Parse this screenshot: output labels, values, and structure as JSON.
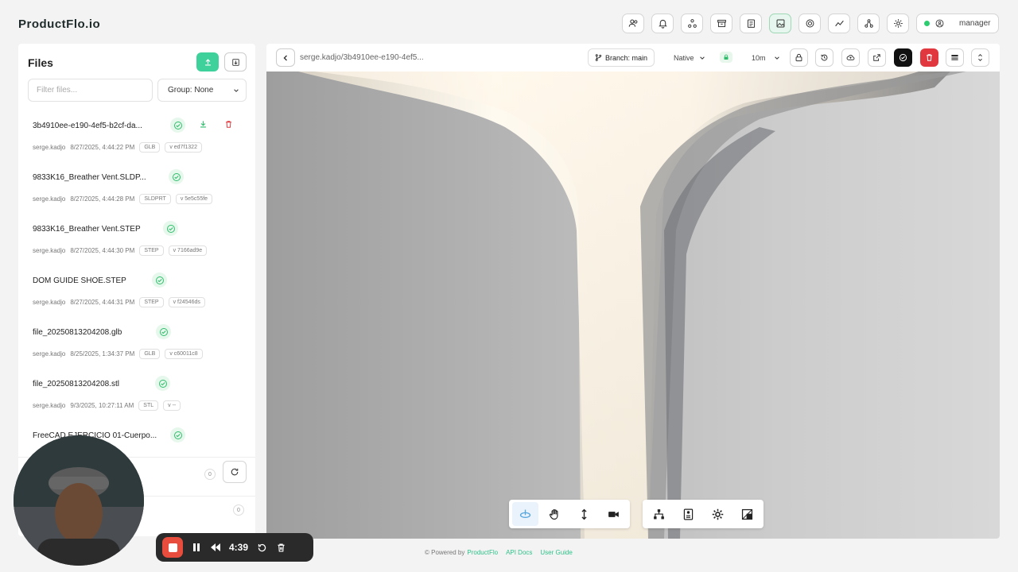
{
  "app": {
    "brand": "ProductFlo.io"
  },
  "topbar": {
    "buttons": [
      {
        "icon": "users-icon"
      },
      {
        "icon": "bell-icon"
      },
      {
        "icon": "nodes-icon"
      },
      {
        "icon": "archive-icon"
      },
      {
        "icon": "clipboard-icon"
      },
      {
        "icon": "image-icon",
        "active": true
      },
      {
        "icon": "target-icon"
      },
      {
        "icon": "chart-icon"
      },
      {
        "icon": "share-icon"
      },
      {
        "icon": "gear-icon"
      }
    ],
    "user": {
      "status_color": "#2ecc71",
      "label": "manager"
    }
  },
  "files_panel": {
    "title": "Files",
    "filter_placeholder": "Filter files...",
    "group_label": "Group: None",
    "items": [
      {
        "name": "3b4910ee-e190-4ef5-b2cf-da...",
        "user": "serge.kadjo",
        "date": "8/27/2025, 4:44:22 PM",
        "type": "GLB",
        "version": "v ed7f1322",
        "actions": true
      },
      {
        "name": "9833K16_Breather Vent.SLDP...",
        "user": "serge.kadjo",
        "date": "8/27/2025, 4:44:28 PM",
        "type": "SLDPRT",
        "version": "v 5e5c55fe"
      },
      {
        "name": "9833K16_Breather Vent.STEP",
        "user": "serge.kadjo",
        "date": "8/27/2025, 4:44:30 PM",
        "type": "STEP",
        "version": "v 7166ad9e"
      },
      {
        "name": "DOM GUIDE SHOE.STEP",
        "user": "serge.kadjo",
        "date": "8/27/2025, 4:44:31 PM",
        "type": "STEP",
        "version": "v f24546ds"
      },
      {
        "name": "file_20250813204208.glb",
        "user": "serge.kadjo",
        "date": "8/25/2025, 1:34:37 PM",
        "type": "GLB",
        "version": "v c60011c8"
      },
      {
        "name": "file_20250813204208.stl",
        "user": "serge.kadjo",
        "date": "9/3/2025, 10:27:11 AM",
        "type": "STL",
        "version": "v --"
      },
      {
        "name": "FreeCAD EJERCICIO 01-Cuerpo...",
        "user": "",
        "date": "",
        "type": "",
        "version": ""
      }
    ],
    "count1": "0",
    "count2": "0"
  },
  "viewer": {
    "path": "serge.kadjo/3b4910ee-e190-4ef5...",
    "branch_label": "Branch: main",
    "render_mode": "Native",
    "interval": "10m"
  },
  "footer": {
    "powered": "© Powered by",
    "brand_link": "ProductFlo",
    "api_docs": "API Docs",
    "user_guide": "User Guide"
  },
  "recorder": {
    "time": "4:39"
  },
  "colors": {
    "accent": "#3fd19b",
    "danger": "#e0383e",
    "check_bg": "#e6f7ec"
  }
}
